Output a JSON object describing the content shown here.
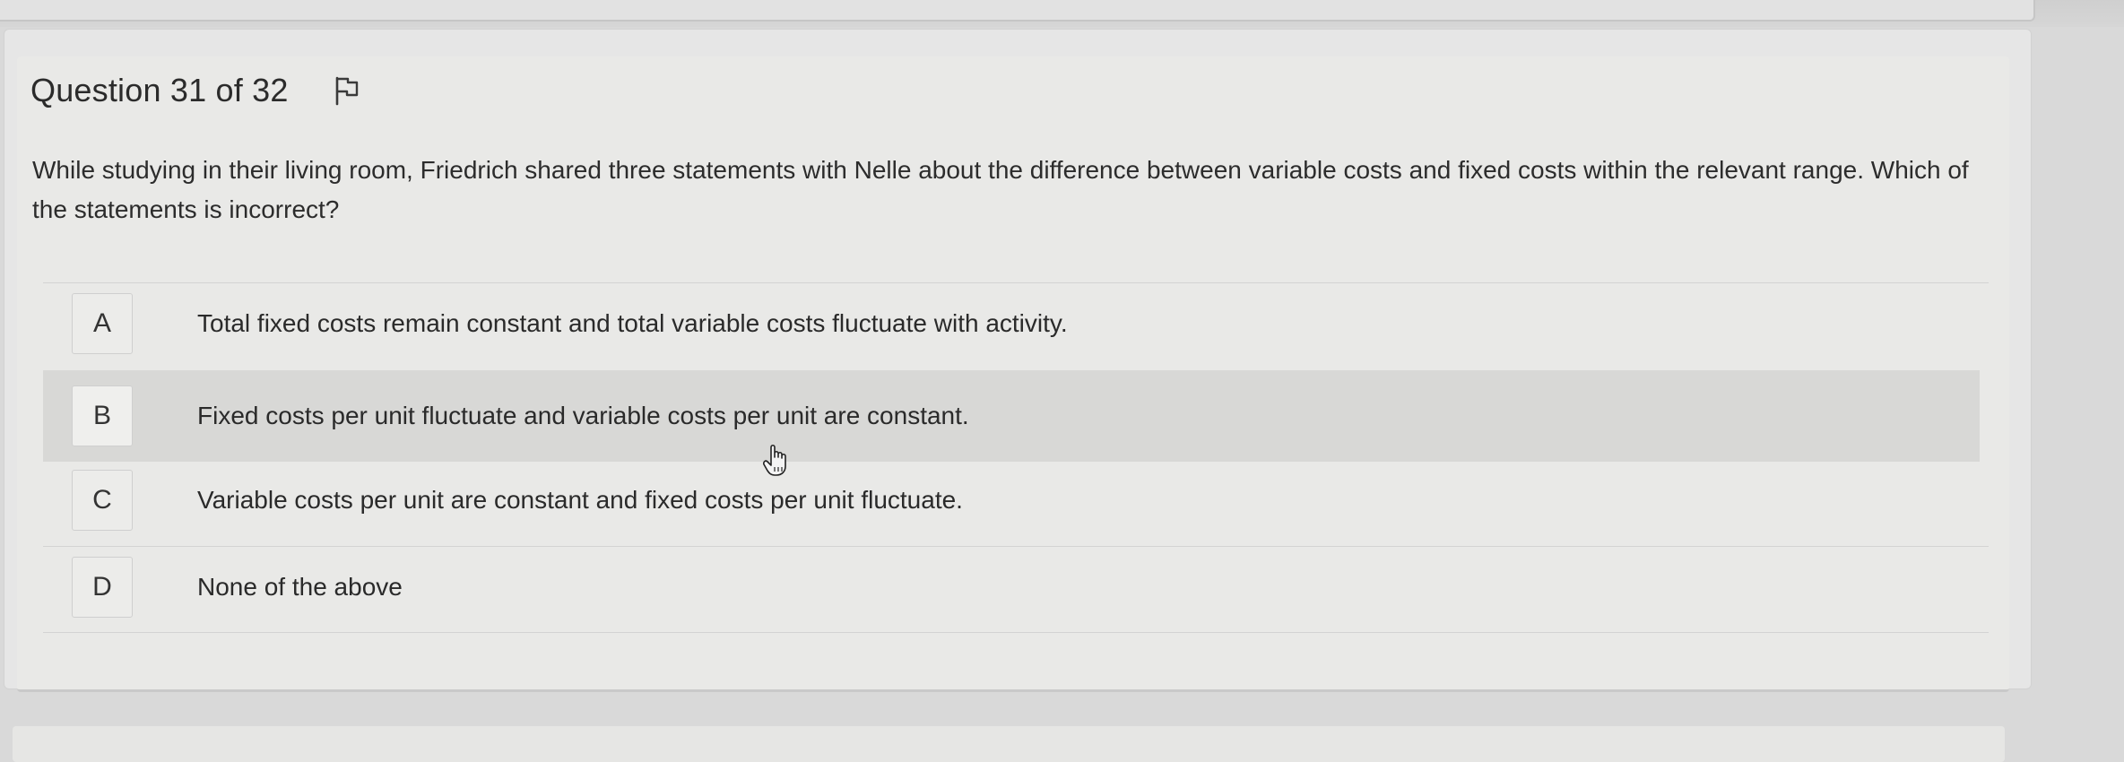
{
  "question": {
    "title": "Question 31 of 32",
    "flag_icon": "flag-icon",
    "prompt": "While studying in their living room, Friedrich shared three statements with Nelle about the difference between variable costs and fixed costs within the relevant range. Which of the statements is incorrect?"
  },
  "options": [
    {
      "letter": "A",
      "text": "Total fixed costs remain constant and total variable costs fluctuate with activity."
    },
    {
      "letter": "B",
      "text": "Fixed costs per unit fluctuate and variable costs per unit are constant."
    },
    {
      "letter": "C",
      "text": "Variable costs per unit are constant and fixed costs per unit fluctuate."
    },
    {
      "letter": "D",
      "text": "None of the above"
    }
  ],
  "colors": {
    "background": "#d9d9d9",
    "card": "#e9e9e7",
    "hover_row": "#d8d8d6",
    "text": "#2a2a2a"
  },
  "cursor_icon": "hand-pointer-icon"
}
